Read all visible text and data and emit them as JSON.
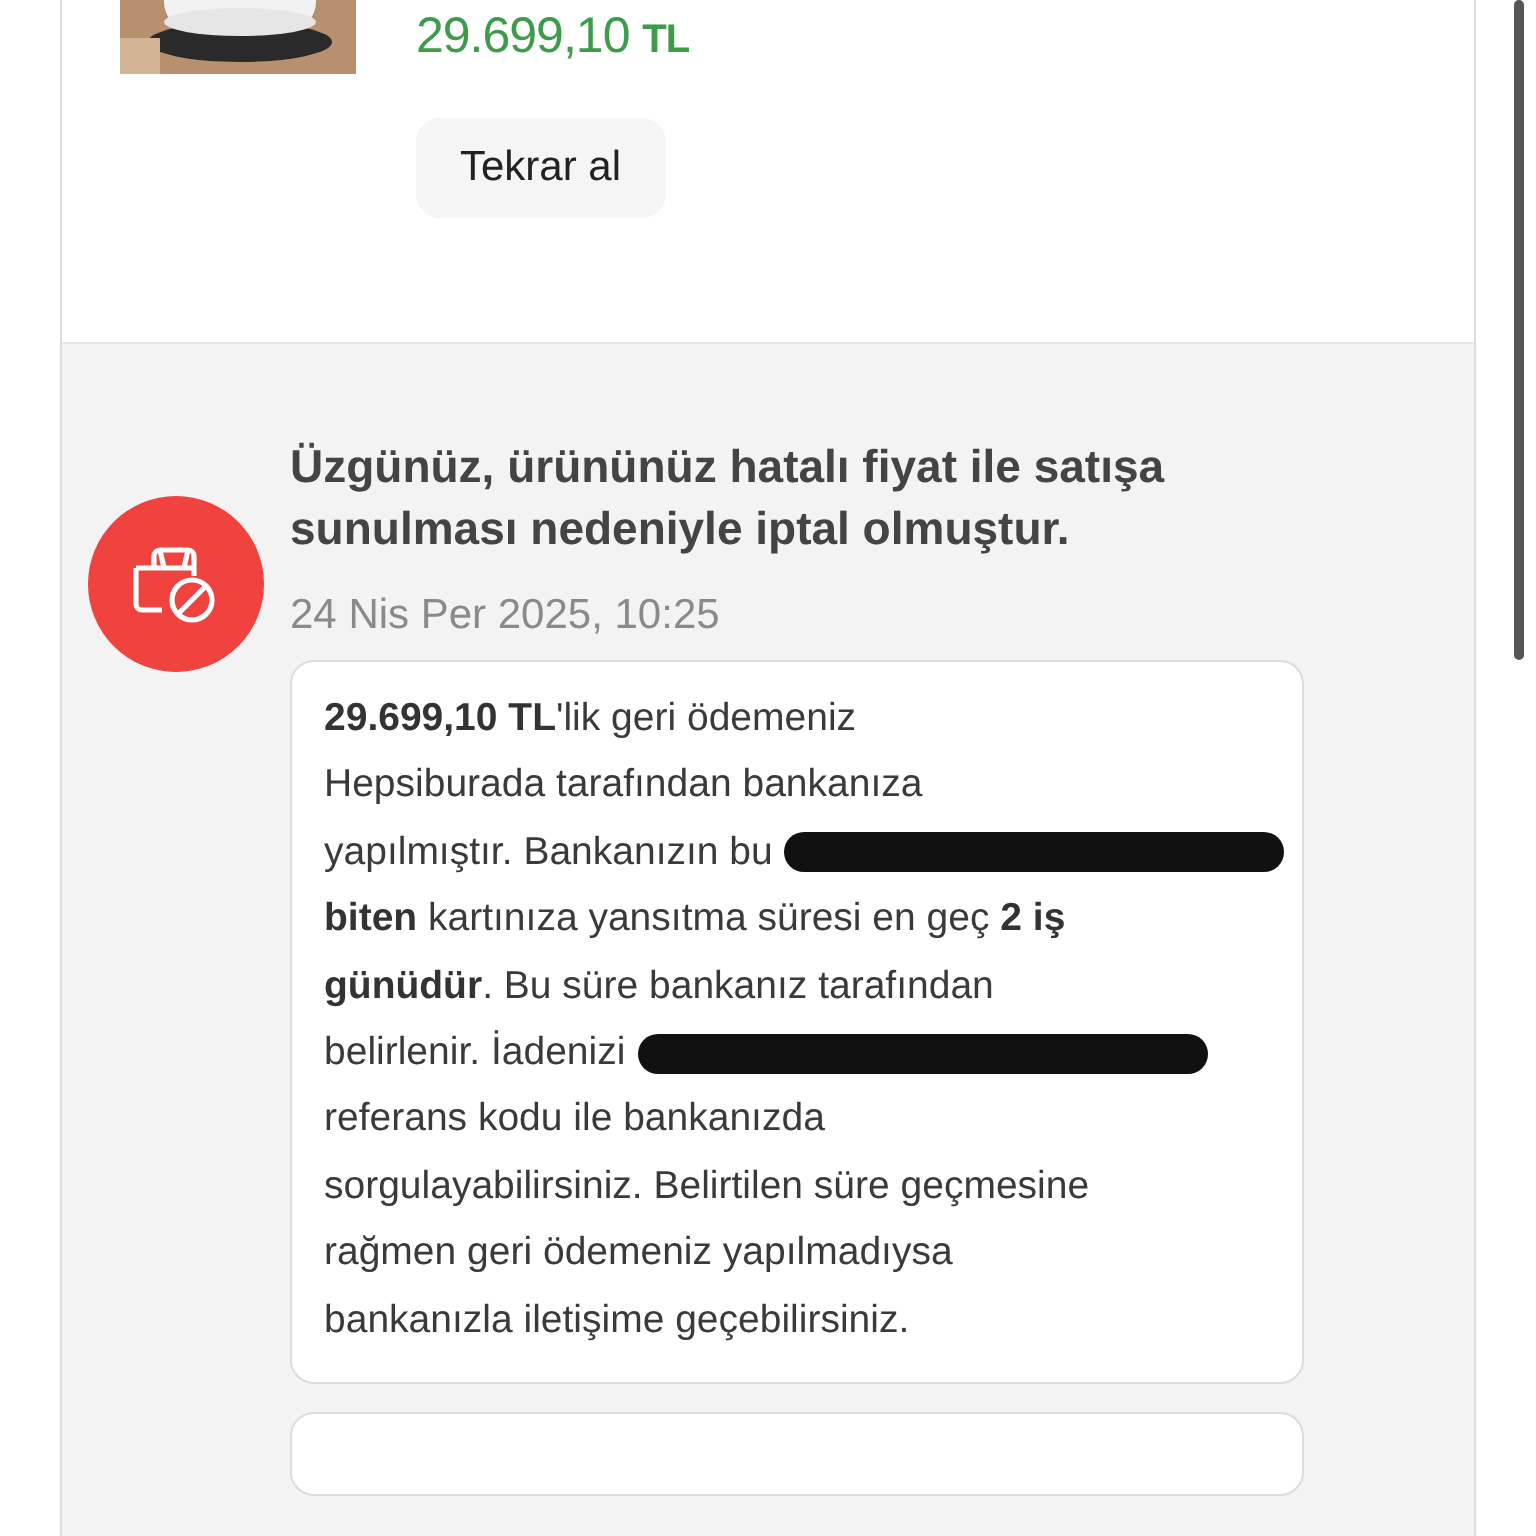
{
  "product": {
    "price": "29.699,10",
    "currency": "TL",
    "reorder_button": "Tekrar al"
  },
  "status_update": {
    "kind": "cancelled",
    "title": "Üzgünüz, ürününüz hatalı fiyat ile satışa sunulması nedeniyle iptal olmuştur.",
    "date": "24 Nis Per 2025, 10:25",
    "message": [
      {
        "text": "**29.699,10 TL**'lik geri ödemeniz",
        "redacted": false
      },
      {
        "text": "Hepsiburada tarafından bankanıza",
        "redacted": false
      },
      {
        "text": "yapılmıştır. Bankanızın bu",
        "redacted": true
      },
      {
        "text": "**biten** kartınıza yansıtma süresi en geç **2 iş**",
        "redacted": false
      },
      {
        "text": "**günüdür**. Bu süre bankanız tarafından",
        "redacted": false
      },
      {
        "text": "belirlenir. İadenizi",
        "redacted": true
      },
      {
        "text": "referans kodu ile bankanızda",
        "redacted": false
      },
      {
        "text": "sorgulayabilirsiniz. Belirtilen süre geçmesine",
        "redacted": false
      },
      {
        "text": "rağmen geri ödemeniz yapılmadıysa",
        "redacted": false
      },
      {
        "text": "bankanızla iletişime geçebilirsiniz.",
        "redacted": false
      }
    ]
  }
}
